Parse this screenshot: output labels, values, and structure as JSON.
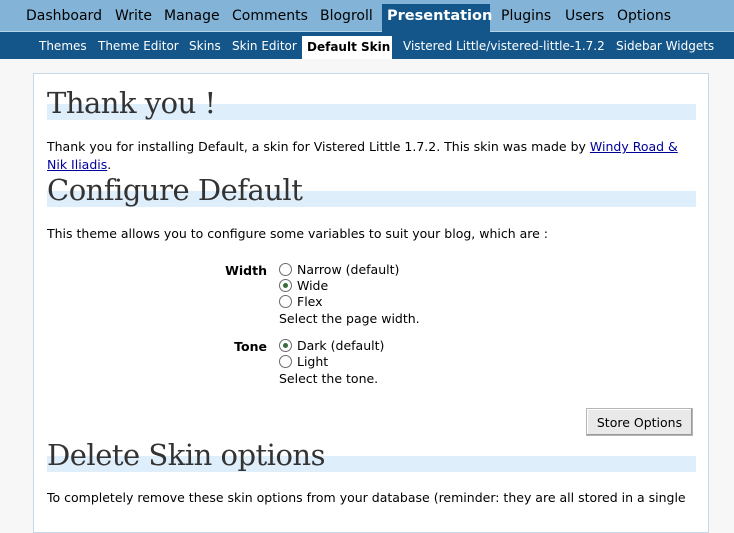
{
  "top_nav": {
    "items": [
      "Dashboard",
      "Write",
      "Manage",
      "Comments",
      "Blogroll",
      "Presentation",
      "Plugins",
      "Users",
      "Options"
    ],
    "active": "Presentation"
  },
  "sub_nav": {
    "items": [
      "Themes",
      "Theme Editor",
      "Skins",
      "Skin Editor",
      "Default Skin",
      "Vistered Little/vistered-little-1.7.2",
      "Sidebar Widgets"
    ],
    "active": "Default Skin"
  },
  "thanks": {
    "heading": "Thank you !",
    "text_before": "Thank you for installing Default, a skin for Vistered Little 1.7.2. This skin was made by ",
    "author_link_line1": "Windy Road &",
    "author_link_line2": "Nik Iliadis",
    "text_after": "."
  },
  "configure": {
    "heading": "Configure Default",
    "intro": "This theme allows you to configure some variables to suit your blog, which are :",
    "width": {
      "label": "Width",
      "options": [
        "Narrow (default)",
        "Wide",
        "Flex"
      ],
      "selected": "Wide",
      "hint": "Select the page width."
    },
    "tone": {
      "label": "Tone",
      "options": [
        "Dark (default)",
        "Light"
      ],
      "selected": "Dark (default)",
      "hint": "Select the tone."
    },
    "store_button": "Store Options"
  },
  "delete": {
    "heading": "Delete Skin options",
    "text": "To completely remove these skin options from your database (reminder: they are all stored in a single"
  },
  "colors": {
    "top_nav_bg": "#83b4d8",
    "sub_nav_bg": "#14568a",
    "heading_bar": "#dfeefb",
    "link": "#00019b"
  }
}
